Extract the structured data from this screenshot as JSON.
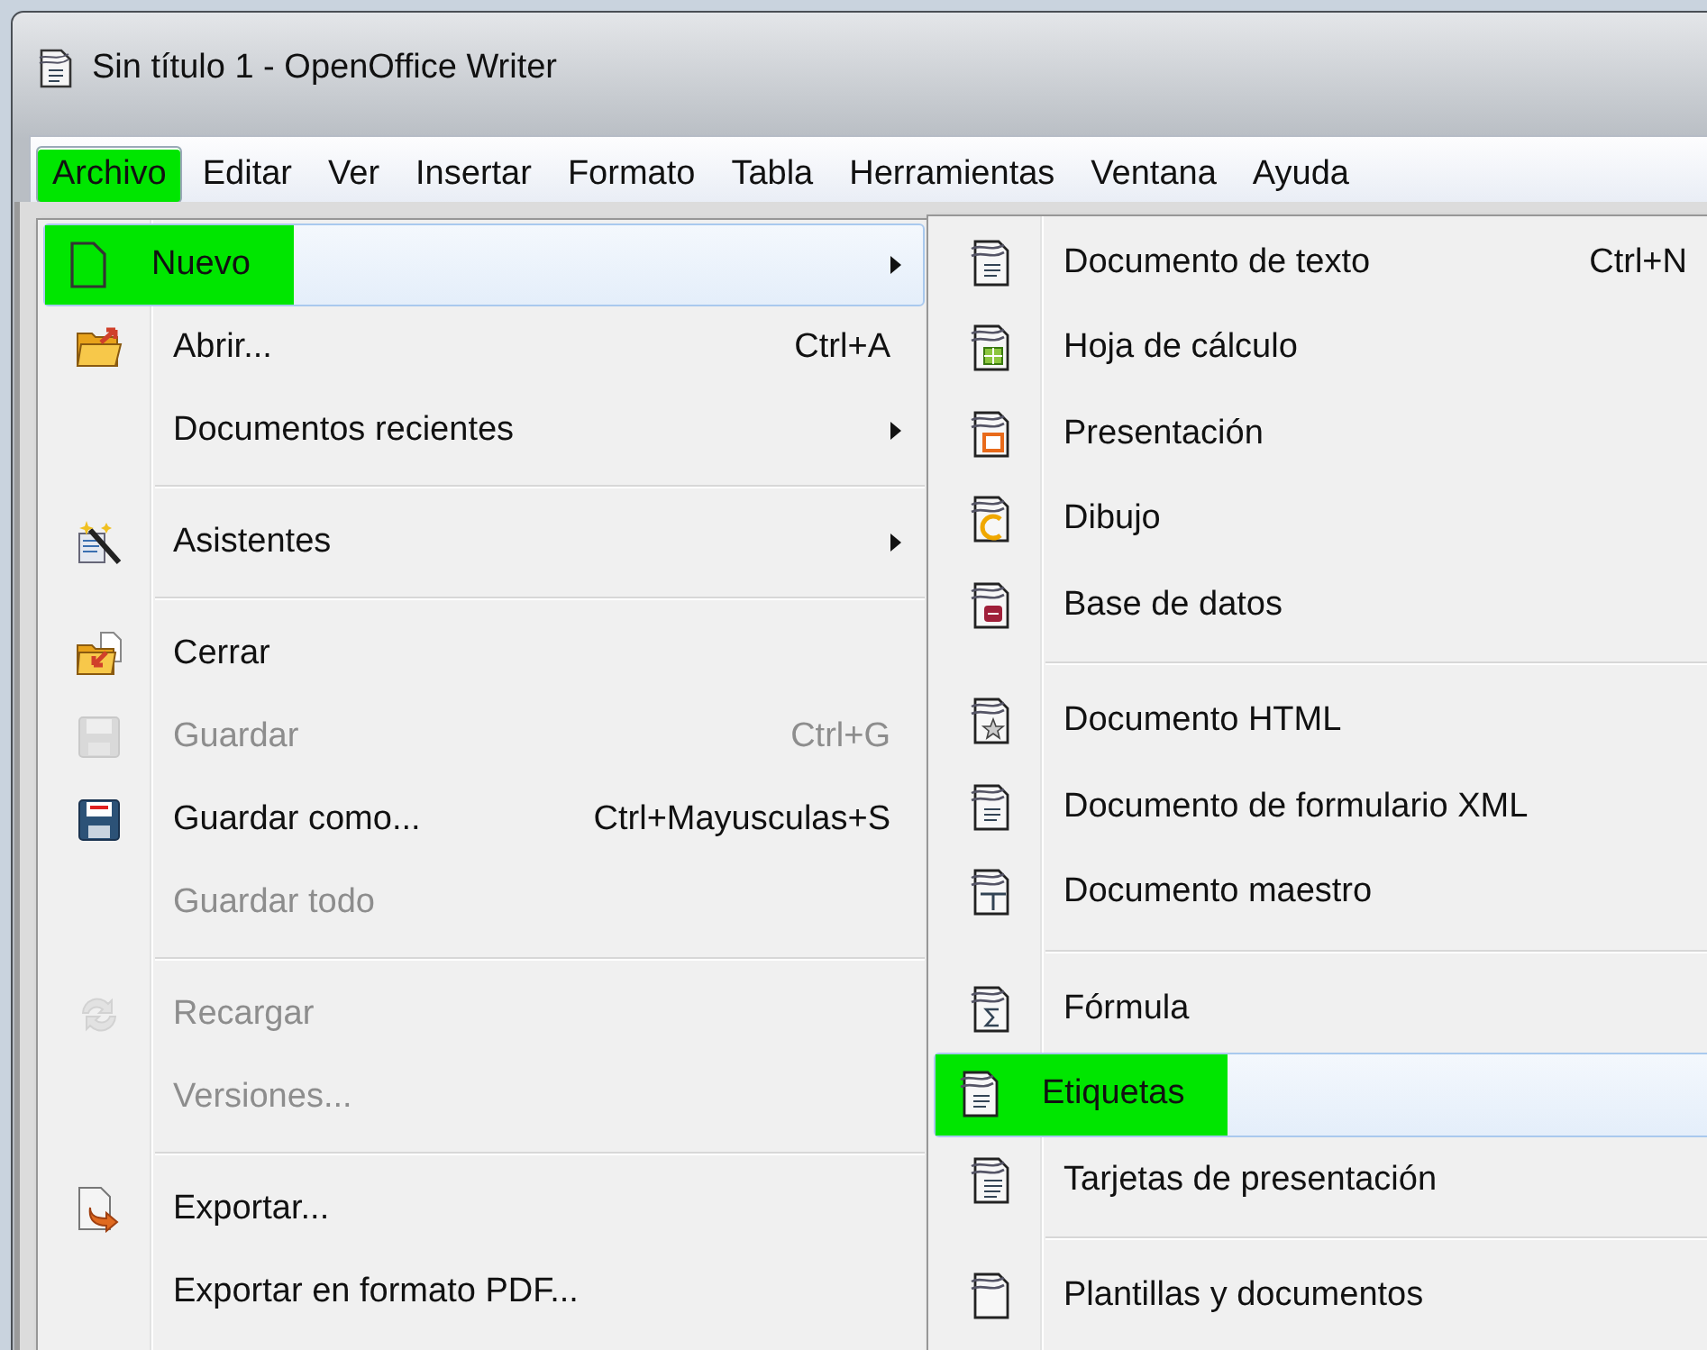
{
  "window": {
    "title": "Sin título 1 - OpenOffice Writer"
  },
  "menu_bar": [
    {
      "label": "Archivo",
      "selected": true,
      "highlighted": true
    },
    {
      "label": "Editar",
      "selected": false,
      "highlighted": false
    },
    {
      "label": "Ver",
      "selected": false,
      "highlighted": false
    },
    {
      "label": "Insertar",
      "selected": false,
      "highlighted": false
    },
    {
      "label": "Formato",
      "selected": false,
      "highlighted": false
    },
    {
      "label": "Tabla",
      "selected": false,
      "highlighted": false
    },
    {
      "label": "Herramientas",
      "selected": false,
      "highlighted": false
    },
    {
      "label": "Ventana",
      "selected": false,
      "highlighted": false
    },
    {
      "label": "Ayuda",
      "selected": false,
      "highlighted": false
    }
  ],
  "file_menu": {
    "items": [
      {
        "kind": "item",
        "label": "Nuevo",
        "submenu": true,
        "disabled": false,
        "selected": true,
        "highlighted": true
      },
      {
        "kind": "item",
        "label": "Abrir...",
        "shortcut": "Ctrl+A",
        "submenu": false,
        "disabled": false,
        "selected": false,
        "highlighted": false
      },
      {
        "kind": "item",
        "label": "Documentos recientes",
        "submenu": true,
        "disabled": false,
        "selected": false,
        "highlighted": false
      },
      {
        "kind": "separator"
      },
      {
        "kind": "item",
        "label": "Asistentes",
        "submenu": true,
        "disabled": false,
        "selected": false,
        "highlighted": false
      },
      {
        "kind": "separator"
      },
      {
        "kind": "item",
        "label": "Cerrar",
        "submenu": false,
        "disabled": false,
        "selected": false,
        "highlighted": false
      },
      {
        "kind": "item",
        "label": "Guardar",
        "shortcut": "Ctrl+G",
        "submenu": false,
        "disabled": true,
        "selected": false,
        "highlighted": false
      },
      {
        "kind": "item",
        "label": "Guardar como...",
        "shortcut": "Ctrl+Mayusculas+S",
        "submenu": false,
        "disabled": false,
        "selected": false,
        "highlighted": false
      },
      {
        "kind": "item",
        "label": "Guardar todo",
        "submenu": false,
        "disabled": true,
        "selected": false,
        "highlighted": false
      },
      {
        "kind": "separator"
      },
      {
        "kind": "item",
        "label": "Recargar",
        "submenu": false,
        "disabled": true,
        "selected": false,
        "highlighted": false
      },
      {
        "kind": "item",
        "label": "Versiones...",
        "submenu": false,
        "disabled": true,
        "selected": false,
        "highlighted": false
      },
      {
        "kind": "separator"
      },
      {
        "kind": "item",
        "label": "Exportar...",
        "submenu": false,
        "disabled": false,
        "selected": false,
        "highlighted": false
      },
      {
        "kind": "item",
        "label": "Exportar en formato PDF...",
        "submenu": false,
        "disabled": false,
        "selected": false,
        "highlighted": false
      }
    ]
  },
  "new_submenu": {
    "items": [
      {
        "kind": "item",
        "label": "Documento de texto",
        "shortcut": "Ctrl+N",
        "submenu": false,
        "disabled": false,
        "selected": false,
        "highlighted": false
      },
      {
        "kind": "item",
        "label": "Hoja de cálculo",
        "submenu": false,
        "disabled": false,
        "selected": false,
        "highlighted": false
      },
      {
        "kind": "item",
        "label": "Presentación",
        "submenu": false,
        "disabled": false,
        "selected": false,
        "highlighted": false
      },
      {
        "kind": "item",
        "label": "Dibujo",
        "submenu": false,
        "disabled": false,
        "selected": false,
        "highlighted": false
      },
      {
        "kind": "item",
        "label": "Base de datos",
        "submenu": false,
        "disabled": false,
        "selected": false,
        "highlighted": false
      },
      {
        "kind": "separator"
      },
      {
        "kind": "item",
        "label": "Documento HTML",
        "submenu": false,
        "disabled": false,
        "selected": false,
        "highlighted": false
      },
      {
        "kind": "item",
        "label": "Documento de formulario XML",
        "submenu": false,
        "disabled": false,
        "selected": false,
        "highlighted": false
      },
      {
        "kind": "item",
        "label": "Documento maestro",
        "submenu": false,
        "disabled": false,
        "selected": false,
        "highlighted": false
      },
      {
        "kind": "separator"
      },
      {
        "kind": "item",
        "label": "Fórmula",
        "submenu": false,
        "disabled": false,
        "selected": false,
        "highlighted": false
      },
      {
        "kind": "item",
        "label": "Etiquetas",
        "submenu": false,
        "disabled": false,
        "selected": true,
        "highlighted": true
      },
      {
        "kind": "item",
        "label": "Tarjetas de presentación",
        "submenu": false,
        "disabled": false,
        "selected": false,
        "highlighted": false
      },
      {
        "kind": "separator"
      },
      {
        "kind": "item",
        "label": "Plantillas y documentos",
        "submenu": false,
        "disabled": false,
        "selected": false,
        "highlighted": false
      }
    ]
  }
}
